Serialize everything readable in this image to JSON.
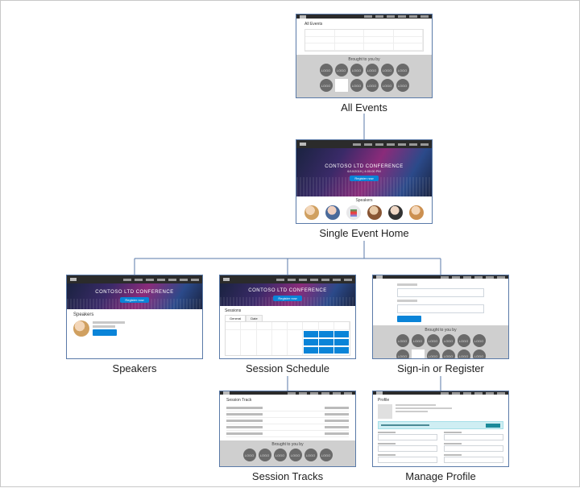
{
  "nodes": {
    "all_events": {
      "caption": "All Events",
      "body_heading": "All Events"
    },
    "single_event": {
      "caption": "Single Event Home",
      "hero_title": "CONTOSO LTD CONFERENCE",
      "hero_subtitle": "6/10/2019 | 4:00:00 PM",
      "hero_button": "Register now",
      "section_label": "Speakers"
    },
    "speakers": {
      "caption": "Speakers",
      "body_heading": "Speakers"
    },
    "schedule": {
      "caption": "Session Schedule",
      "body_heading": "Sessions",
      "tab1": "General",
      "tab2": "Date"
    },
    "signin": {
      "caption": "Sign-in or Register"
    },
    "tracks": {
      "caption": "Session Tracks",
      "body_heading": "Session Track"
    },
    "profile": {
      "caption": "Manage Profile",
      "body_heading": "Profile"
    }
  },
  "sponsors_label": "Brought to you by",
  "logo_text": "LOGO"
}
